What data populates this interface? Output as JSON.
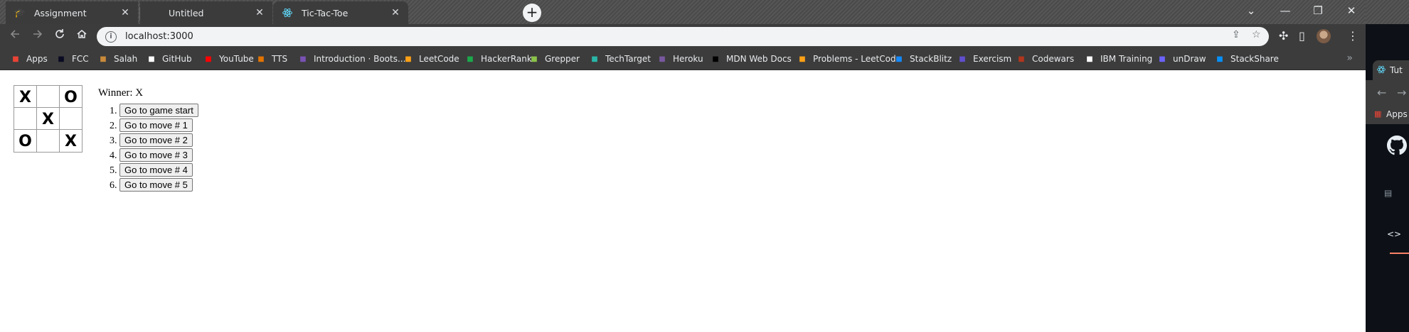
{
  "tabs": [
    {
      "title": "Assignment",
      "favicon": "moodle-icon",
      "close": "✕"
    },
    {
      "title": "Untitled",
      "favicon": "",
      "close": "✕"
    },
    {
      "title": "Tic-Tac-Toe",
      "favicon": "react-icon",
      "close": "✕"
    }
  ],
  "new_tab": "+",
  "window_controls": {
    "minimize": "—",
    "restore": "❐",
    "close": "✕",
    "tab_search": "⌄"
  },
  "address_bar": {
    "url": "localhost:3000"
  },
  "bookmarks": [
    {
      "label": "Apps",
      "icon": "apps-grid-icon",
      "color": "#ea4335"
    },
    {
      "label": "FCC",
      "icon": "fcc-icon",
      "color": "#0a0a23"
    },
    {
      "label": "Salah",
      "icon": "salah-icon",
      "color": "#c98a3a"
    },
    {
      "label": "GitHub",
      "icon": "github-icon",
      "color": "#ffffff"
    },
    {
      "label": "YouTube",
      "icon": "youtube-icon",
      "color": "#ff0000"
    },
    {
      "label": "TTS",
      "icon": "tts-icon",
      "color": "#e37400"
    },
    {
      "label": "Introduction · Boots...",
      "icon": "bootstrap-icon",
      "color": "#7952b3"
    },
    {
      "label": "LeetCode",
      "icon": "leetcode-icon",
      "color": "#ffa116"
    },
    {
      "label": "HackerRank",
      "icon": "hackerrank-icon",
      "color": "#1ba94c"
    },
    {
      "label": "Grepper",
      "icon": "grepper-icon",
      "color": "#8bc34a"
    },
    {
      "label": "TechTarget",
      "icon": "techtarget-icon",
      "color": "#29b6a8"
    },
    {
      "label": "Heroku",
      "icon": "heroku-icon",
      "color": "#79589f"
    },
    {
      "label": "MDN Web Docs",
      "icon": "mdn-icon",
      "color": "#000000"
    },
    {
      "label": "Problems - LeetCode",
      "icon": "leetcode-icon",
      "color": "#ffa116"
    },
    {
      "label": "StackBlitz",
      "icon": "stackblitz-icon",
      "color": "#1389fd"
    },
    {
      "label": "Exercism",
      "icon": "exercism-icon",
      "color": "#604fcd"
    },
    {
      "label": "Codewars",
      "icon": "codewars-icon",
      "color": "#b1361e"
    },
    {
      "label": "IBM Training",
      "icon": "ibm-icon",
      "color": "#ffffff"
    },
    {
      "label": "unDraw",
      "icon": "undraw-icon",
      "color": "#6c63ff"
    },
    {
      "label": "StackShare",
      "icon": "stackshare-icon",
      "color": "#0690fa"
    }
  ],
  "bookmarks_more": "»",
  "game": {
    "squares": [
      "X",
      "",
      "O",
      "",
      "X",
      "",
      "O",
      "",
      "X"
    ],
    "status": "Winner: X",
    "moves": [
      "Go to game start",
      "Go to move # 1",
      "Go to move # 2",
      "Go to move # 3",
      "Go to move # 4",
      "Go to move # 5"
    ]
  },
  "second_window": {
    "tab_title": "Tut",
    "bookmark_label": "Apps"
  }
}
